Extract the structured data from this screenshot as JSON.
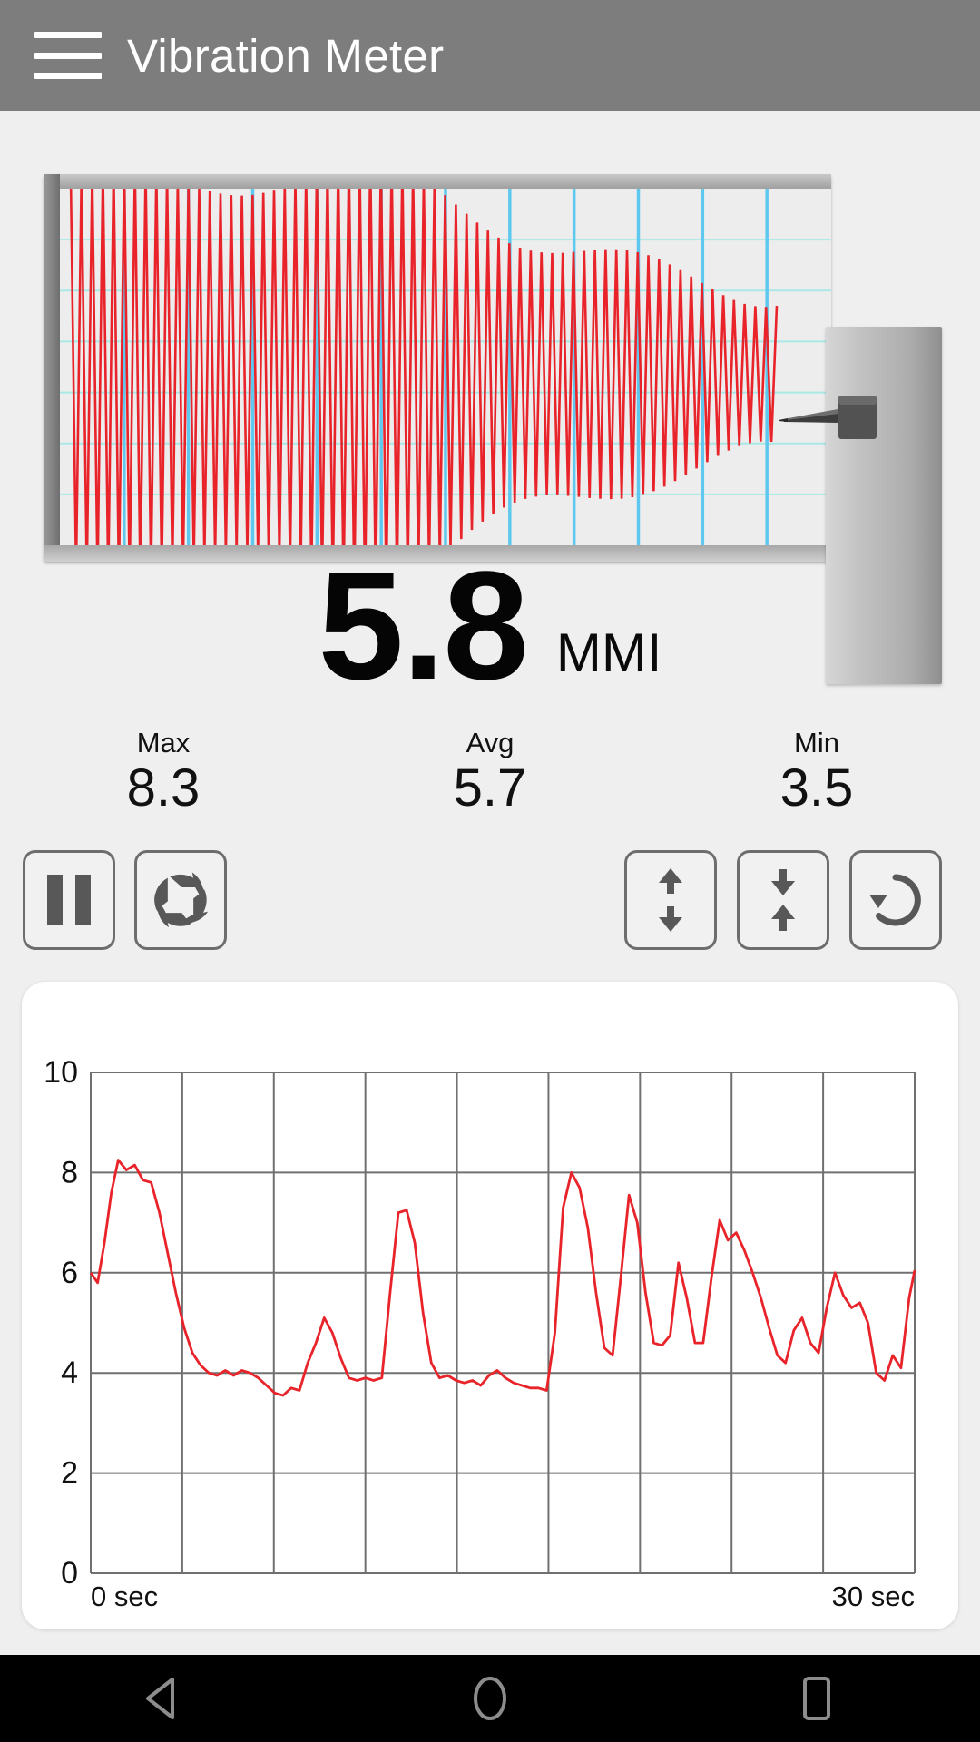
{
  "app": {
    "title": "Vibration Meter",
    "appbar_bg": "#7d7d7d",
    "page_bg": "#efefef",
    "menu_icon": "hamburger-icon"
  },
  "recorder": {
    "name": "seismograph-paper-recorder",
    "trace_color": "#e8232a",
    "grid_major_color": "#5ec8ef",
    "grid_minor_color": "#a8e8e6",
    "paper_color": "#ededed",
    "pen_icon": "recorder-pen"
  },
  "reading": {
    "value": "5.8",
    "unit": "MMI"
  },
  "stats": [
    {
      "label": "Max",
      "value": "8.3"
    },
    {
      "label": "Avg",
      "value": "5.7"
    },
    {
      "label": "Min",
      "value": "3.5"
    }
  ],
  "controls": [
    {
      "name": "pause-button",
      "icon": "pause-icon",
      "label": "Pause"
    },
    {
      "name": "snapshot-button",
      "icon": "camera-aperture-icon",
      "label": "Snapshot"
    },
    {
      "name": "zoom-in-button",
      "icon": "expand-vertical-icon",
      "label": "Zoom In"
    },
    {
      "name": "zoom-out-button",
      "icon": "collapse-vertical-icon",
      "label": "Zoom Out"
    },
    {
      "name": "reset-button",
      "icon": "reset-rotate-icon",
      "label": "Reset"
    }
  ],
  "navbar": [
    {
      "name": "nav-back-button",
      "icon": "triangle-back-icon"
    },
    {
      "name": "nav-home-button",
      "icon": "circle-home-icon"
    },
    {
      "name": "nav-recents-button",
      "icon": "square-recents-icon"
    }
  ],
  "chart_data": {
    "type": "line",
    "title": "",
    "xlabel": "",
    "ylabel": "",
    "line_color": "#e8232a",
    "grid": true,
    "grid_color": "#707070",
    "legend": "none",
    "xlim": [
      0,
      30
    ],
    "ylim": [
      0,
      10
    ],
    "yticks": [
      0,
      2,
      4,
      6,
      8,
      10
    ],
    "ytick_labels": [
      "0",
      "2",
      "4",
      "6",
      "8",
      "10"
    ],
    "x_axis_start_label": "0 sec",
    "x_axis_end_label": "30 sec",
    "x_gridline_count": 9,
    "x": [
      0.0,
      0.25,
      0.5,
      0.75,
      1.0,
      1.3,
      1.6,
      1.9,
      2.2,
      2.5,
      2.8,
      3.1,
      3.4,
      3.7,
      4.0,
      4.3,
      4.6,
      4.9,
      5.2,
      5.5,
      5.8,
      6.1,
      6.4,
      6.7,
      7.0,
      7.3,
      7.6,
      7.9,
      8.2,
      8.5,
      8.8,
      9.1,
      9.4,
      9.7,
      10.0,
      10.3,
      10.6,
      10.9,
      11.2,
      11.5,
      11.8,
      12.1,
      12.4,
      12.7,
      13.0,
      13.3,
      13.6,
      13.9,
      14.2,
      14.5,
      14.8,
      15.1,
      15.4,
      15.7,
      16.0,
      16.3,
      16.6,
      16.9,
      17.2,
      17.5,
      17.8,
      18.1,
      18.4,
      18.7,
      19.0,
      19.3,
      19.6,
      19.9,
      20.2,
      20.5,
      20.8,
      21.1,
      21.4,
      21.7,
      22.0,
      22.3,
      22.6,
      22.9,
      23.2,
      23.5,
      23.8,
      24.1,
      24.4,
      24.7,
      25.0,
      25.3,
      25.6,
      25.9,
      26.2,
      26.5,
      26.8,
      27.1,
      27.4,
      27.7,
      28.0,
      28.3,
      28.6,
      28.9,
      29.2,
      29.5,
      29.8,
      30.0
    ],
    "values": [
      6.0,
      5.8,
      6.6,
      7.6,
      8.25,
      8.05,
      8.15,
      7.85,
      7.8,
      7.2,
      6.4,
      5.6,
      4.9,
      4.4,
      4.15,
      4.0,
      3.95,
      4.05,
      3.95,
      4.05,
      4.0,
      3.9,
      3.75,
      3.6,
      3.55,
      3.7,
      3.65,
      4.2,
      4.6,
      5.1,
      4.8,
      4.3,
      3.9,
      3.85,
      3.9,
      3.85,
      3.9,
      5.6,
      7.2,
      7.25,
      6.6,
      5.2,
      4.2,
      3.9,
      3.95,
      3.85,
      3.8,
      3.85,
      3.75,
      3.95,
      4.05,
      3.9,
      3.8,
      3.75,
      3.7,
      3.7,
      3.65,
      4.8,
      7.3,
      8.0,
      7.7,
      6.9,
      5.6,
      4.5,
      4.35,
      5.9,
      7.55,
      7.0,
      5.6,
      4.6,
      4.55,
      4.75,
      6.2,
      5.5,
      4.6,
      4.6,
      5.9,
      7.05,
      6.65,
      6.8,
      6.45,
      6.0,
      5.5,
      4.9,
      4.35,
      4.2,
      4.85,
      5.1,
      4.6,
      4.4,
      5.3,
      6.0,
      5.55,
      5.3,
      5.4,
      5.0,
      4.0,
      3.85,
      4.35,
      4.1,
      5.5,
      6.05
    ]
  }
}
